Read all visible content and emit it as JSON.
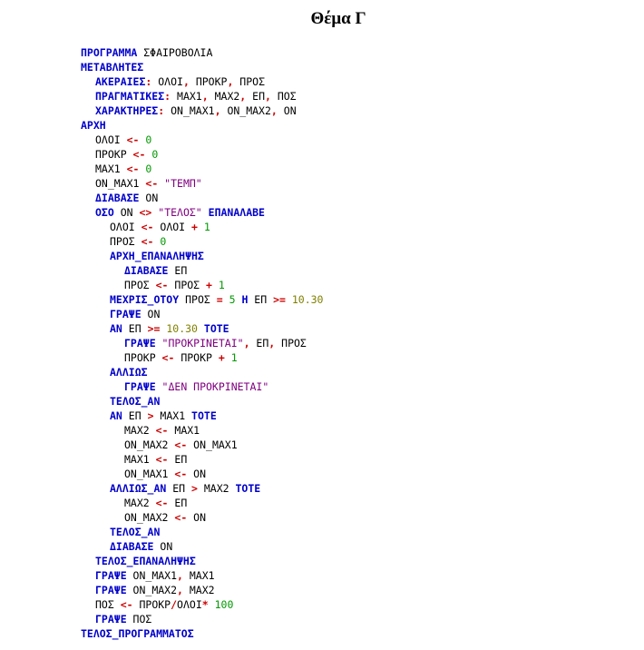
{
  "title": "Θέμα Γ",
  "code_lines": [
    {
      "indent": 0,
      "tokens": [
        {
          "t": "ΠΡΟΓΡΑΜΜΑ",
          "c": "kw"
        },
        {
          "t": " ΣΦΑΙΡΟΒΟΛΙΑ",
          "c": "id"
        }
      ]
    },
    {
      "indent": 0,
      "tokens": [
        {
          "t": "ΜΕΤΑΒΛΗΤΕΣ",
          "c": "kw"
        }
      ]
    },
    {
      "indent": 2,
      "tokens": [
        {
          "t": "ΑΚΕΡΑΙΕΣ",
          "c": "kw"
        },
        {
          "t": ":",
          "c": "op"
        },
        {
          "t": " ΟΛΟΙ",
          "c": "id"
        },
        {
          "t": ",",
          "c": "op"
        },
        {
          "t": " ΠΡΟΚΡ",
          "c": "id"
        },
        {
          "t": ",",
          "c": "op"
        },
        {
          "t": " ΠΡΟΣ",
          "c": "id"
        }
      ]
    },
    {
      "indent": 2,
      "tokens": [
        {
          "t": "ΠΡΑΓΜΑΤΙΚΕΣ",
          "c": "kw"
        },
        {
          "t": ":",
          "c": "op"
        },
        {
          "t": " MAX1",
          "c": "id"
        },
        {
          "t": ",",
          "c": "op"
        },
        {
          "t": " MAX2",
          "c": "id"
        },
        {
          "t": ",",
          "c": "op"
        },
        {
          "t": " ΕΠ",
          "c": "id"
        },
        {
          "t": ",",
          "c": "op"
        },
        {
          "t": " ΠΟΣ",
          "c": "id"
        }
      ]
    },
    {
      "indent": 2,
      "tokens": [
        {
          "t": "ΧΑΡΑΚΤΗΡΕΣ",
          "c": "kw"
        },
        {
          "t": ":",
          "c": "op"
        },
        {
          "t": " ON_MAX1",
          "c": "id"
        },
        {
          "t": ",",
          "c": "op"
        },
        {
          "t": " ON_MAX2",
          "c": "id"
        },
        {
          "t": ",",
          "c": "op"
        },
        {
          "t": " ON",
          "c": "id"
        }
      ]
    },
    {
      "indent": 0,
      "tokens": [
        {
          "t": "ΑΡΧΗ",
          "c": "kw"
        }
      ]
    },
    {
      "indent": 2,
      "tokens": [
        {
          "t": "ΟΛΟΙ ",
          "c": "id"
        },
        {
          "t": "<-",
          "c": "op"
        },
        {
          "t": " 0",
          "c": "num"
        }
      ]
    },
    {
      "indent": 2,
      "tokens": [
        {
          "t": "ΠΡΟΚΡ ",
          "c": "id"
        },
        {
          "t": "<-",
          "c": "op"
        },
        {
          "t": " 0",
          "c": "num"
        }
      ]
    },
    {
      "indent": 2,
      "tokens": [
        {
          "t": "MAX1 ",
          "c": "id"
        },
        {
          "t": "<-",
          "c": "op"
        },
        {
          "t": " 0",
          "c": "num"
        }
      ]
    },
    {
      "indent": 2,
      "tokens": [
        {
          "t": "ON_MAX1 ",
          "c": "id"
        },
        {
          "t": "<-",
          "c": "op"
        },
        {
          "t": " \"ΤΕΜΠ\"",
          "c": "str"
        }
      ]
    },
    {
      "indent": 2,
      "tokens": [
        {
          "t": "ΔΙΑΒΑΣΕ",
          "c": "kw"
        },
        {
          "t": " ON",
          "c": "id"
        }
      ]
    },
    {
      "indent": 2,
      "tokens": [
        {
          "t": "ΟΣΟ",
          "c": "kw"
        },
        {
          "t": " ON ",
          "c": "id"
        },
        {
          "t": "<>",
          "c": "op"
        },
        {
          "t": " \"ΤΕΛΟΣ\"",
          "c": "str"
        },
        {
          "t": " ΕΠΑΝΑΛΑΒΕ",
          "c": "kw"
        }
      ]
    },
    {
      "indent": 4,
      "tokens": [
        {
          "t": "ΟΛΟΙ ",
          "c": "id"
        },
        {
          "t": "<-",
          "c": "op"
        },
        {
          "t": " ΟΛΟΙ ",
          "c": "id"
        },
        {
          "t": "+",
          "c": "op"
        },
        {
          "t": " 1",
          "c": "num"
        }
      ]
    },
    {
      "indent": 4,
      "tokens": [
        {
          "t": "ΠΡΟΣ ",
          "c": "id"
        },
        {
          "t": "<-",
          "c": "op"
        },
        {
          "t": " 0",
          "c": "num"
        }
      ]
    },
    {
      "indent": 4,
      "tokens": [
        {
          "t": "ΑΡΧΗ_ΕΠΑΝΑΛΗΨΗΣ",
          "c": "kw"
        }
      ]
    },
    {
      "indent": 6,
      "tokens": [
        {
          "t": "ΔΙΑΒΑΣΕ",
          "c": "kw"
        },
        {
          "t": " ΕΠ",
          "c": "id"
        }
      ]
    },
    {
      "indent": 6,
      "tokens": [
        {
          "t": "ΠΡΟΣ ",
          "c": "id"
        },
        {
          "t": "<-",
          "c": "op"
        },
        {
          "t": " ΠΡΟΣ ",
          "c": "id"
        },
        {
          "t": "+",
          "c": "op"
        },
        {
          "t": " 1",
          "c": "num"
        }
      ]
    },
    {
      "indent": 4,
      "tokens": [
        {
          "t": "ΜΕΧΡΙΣ_ΟΤΟΥ",
          "c": "kw"
        },
        {
          "t": " ΠΡΟΣ ",
          "c": "id"
        },
        {
          "t": "=",
          "c": "op"
        },
        {
          "t": " 5",
          "c": "num"
        },
        {
          "t": " Η",
          "c": "kw"
        },
        {
          "t": " ΕΠ ",
          "c": "id"
        },
        {
          "t": ">=",
          "c": "op"
        },
        {
          "t": " 10.30",
          "c": "dec"
        }
      ]
    },
    {
      "indent": 4,
      "tokens": [
        {
          "t": "ΓΡΑΨΕ",
          "c": "kw"
        },
        {
          "t": " ON",
          "c": "id"
        }
      ]
    },
    {
      "indent": 4,
      "tokens": [
        {
          "t": "ΑΝ",
          "c": "kw"
        },
        {
          "t": " ΕΠ ",
          "c": "id"
        },
        {
          "t": ">=",
          "c": "op"
        },
        {
          "t": " 10.30",
          "c": "dec"
        },
        {
          "t": " ΤΟΤΕ",
          "c": "kw"
        }
      ]
    },
    {
      "indent": 6,
      "tokens": [
        {
          "t": "ΓΡΑΨΕ",
          "c": "kw"
        },
        {
          "t": " \"ΠΡΟΚΡΙΝΕΤΑΙ\"",
          "c": "str"
        },
        {
          "t": ",",
          "c": "op"
        },
        {
          "t": " ΕΠ",
          "c": "id"
        },
        {
          "t": ",",
          "c": "op"
        },
        {
          "t": " ΠΡΟΣ",
          "c": "id"
        }
      ]
    },
    {
      "indent": 6,
      "tokens": [
        {
          "t": "ΠΡΟΚΡ ",
          "c": "id"
        },
        {
          "t": "<-",
          "c": "op"
        },
        {
          "t": " ΠΡΟΚΡ ",
          "c": "id"
        },
        {
          "t": "+",
          "c": "op"
        },
        {
          "t": " 1",
          "c": "num"
        }
      ]
    },
    {
      "indent": 4,
      "tokens": [
        {
          "t": "ΑΛΛΙΩΣ",
          "c": "kw"
        }
      ]
    },
    {
      "indent": 6,
      "tokens": [
        {
          "t": "ΓΡΑΨΕ",
          "c": "kw"
        },
        {
          "t": " \"ΔΕΝ ΠΡΟΚΡΙΝΕΤΑΙ\"",
          "c": "str"
        }
      ]
    },
    {
      "indent": 4,
      "tokens": [
        {
          "t": "ΤΕΛΟΣ_ΑΝ",
          "c": "kw"
        }
      ]
    },
    {
      "indent": 4,
      "tokens": [
        {
          "t": "ΑΝ",
          "c": "kw"
        },
        {
          "t": " ΕΠ ",
          "c": "id"
        },
        {
          "t": ">",
          "c": "op"
        },
        {
          "t": " MAX1",
          "c": "id"
        },
        {
          "t": " ΤΟΤΕ",
          "c": "kw"
        }
      ]
    },
    {
      "indent": 6,
      "tokens": [
        {
          "t": "MAX2 ",
          "c": "id"
        },
        {
          "t": "<-",
          "c": "op"
        },
        {
          "t": " MAX1",
          "c": "id"
        }
      ]
    },
    {
      "indent": 6,
      "tokens": [
        {
          "t": "ON_MAX2 ",
          "c": "id"
        },
        {
          "t": "<-",
          "c": "op"
        },
        {
          "t": " ON_MAX1",
          "c": "id"
        }
      ]
    },
    {
      "indent": 6,
      "tokens": [
        {
          "t": "MAX1 ",
          "c": "id"
        },
        {
          "t": "<-",
          "c": "op"
        },
        {
          "t": " ΕΠ",
          "c": "id"
        }
      ]
    },
    {
      "indent": 6,
      "tokens": [
        {
          "t": "ON_MAX1 ",
          "c": "id"
        },
        {
          "t": "<-",
          "c": "op"
        },
        {
          "t": " ON",
          "c": "id"
        }
      ]
    },
    {
      "indent": 4,
      "tokens": [
        {
          "t": "ΑΛΛΙΩΣ_ΑΝ",
          "c": "kw"
        },
        {
          "t": " ΕΠ ",
          "c": "id"
        },
        {
          "t": ">",
          "c": "op"
        },
        {
          "t": " MAX2",
          "c": "id"
        },
        {
          "t": " ΤΟΤΕ",
          "c": "kw"
        }
      ]
    },
    {
      "indent": 6,
      "tokens": [
        {
          "t": "MAX2 ",
          "c": "id"
        },
        {
          "t": "<-",
          "c": "op"
        },
        {
          "t": " ΕΠ",
          "c": "id"
        }
      ]
    },
    {
      "indent": 6,
      "tokens": [
        {
          "t": "ON_MAX2 ",
          "c": "id"
        },
        {
          "t": "<-",
          "c": "op"
        },
        {
          "t": " ON",
          "c": "id"
        }
      ]
    },
    {
      "indent": 4,
      "tokens": [
        {
          "t": "ΤΕΛΟΣ_ΑΝ",
          "c": "kw"
        }
      ]
    },
    {
      "indent": 4,
      "tokens": [
        {
          "t": "ΔΙΑΒΑΣΕ",
          "c": "kw"
        },
        {
          "t": " ON",
          "c": "id"
        }
      ]
    },
    {
      "indent": 2,
      "tokens": [
        {
          "t": "ΤΕΛΟΣ_ΕΠΑΝΑΛΗΨΗΣ",
          "c": "kw"
        }
      ]
    },
    {
      "indent": 2,
      "tokens": [
        {
          "t": "ΓΡΑΨΕ",
          "c": "kw"
        },
        {
          "t": " ON_MAX1",
          "c": "id"
        },
        {
          "t": ",",
          "c": "op"
        },
        {
          "t": " MAX1",
          "c": "id"
        }
      ]
    },
    {
      "indent": 2,
      "tokens": [
        {
          "t": "ΓΡΑΨΕ",
          "c": "kw"
        },
        {
          "t": " ON_MAX2",
          "c": "id"
        },
        {
          "t": ",",
          "c": "op"
        },
        {
          "t": " MAX2",
          "c": "id"
        }
      ]
    },
    {
      "indent": 2,
      "tokens": [
        {
          "t": "ΠΟΣ ",
          "c": "id"
        },
        {
          "t": "<-",
          "c": "op"
        },
        {
          "t": " ΠΡΟΚΡ",
          "c": "id"
        },
        {
          "t": "/",
          "c": "op"
        },
        {
          "t": "ΟΛΟΙ",
          "c": "id"
        },
        {
          "t": "*",
          "c": "op"
        },
        {
          "t": " 100",
          "c": "num"
        }
      ]
    },
    {
      "indent": 2,
      "tokens": [
        {
          "t": "ΓΡΑΨΕ",
          "c": "kw"
        },
        {
          "t": " ΠΟΣ",
          "c": "id"
        }
      ]
    },
    {
      "indent": 0,
      "tokens": [
        {
          "t": "ΤΕΛΟΣ_ΠΡΟΓΡΑΜΜΑΤΟΣ",
          "c": "kw"
        }
      ]
    }
  ]
}
